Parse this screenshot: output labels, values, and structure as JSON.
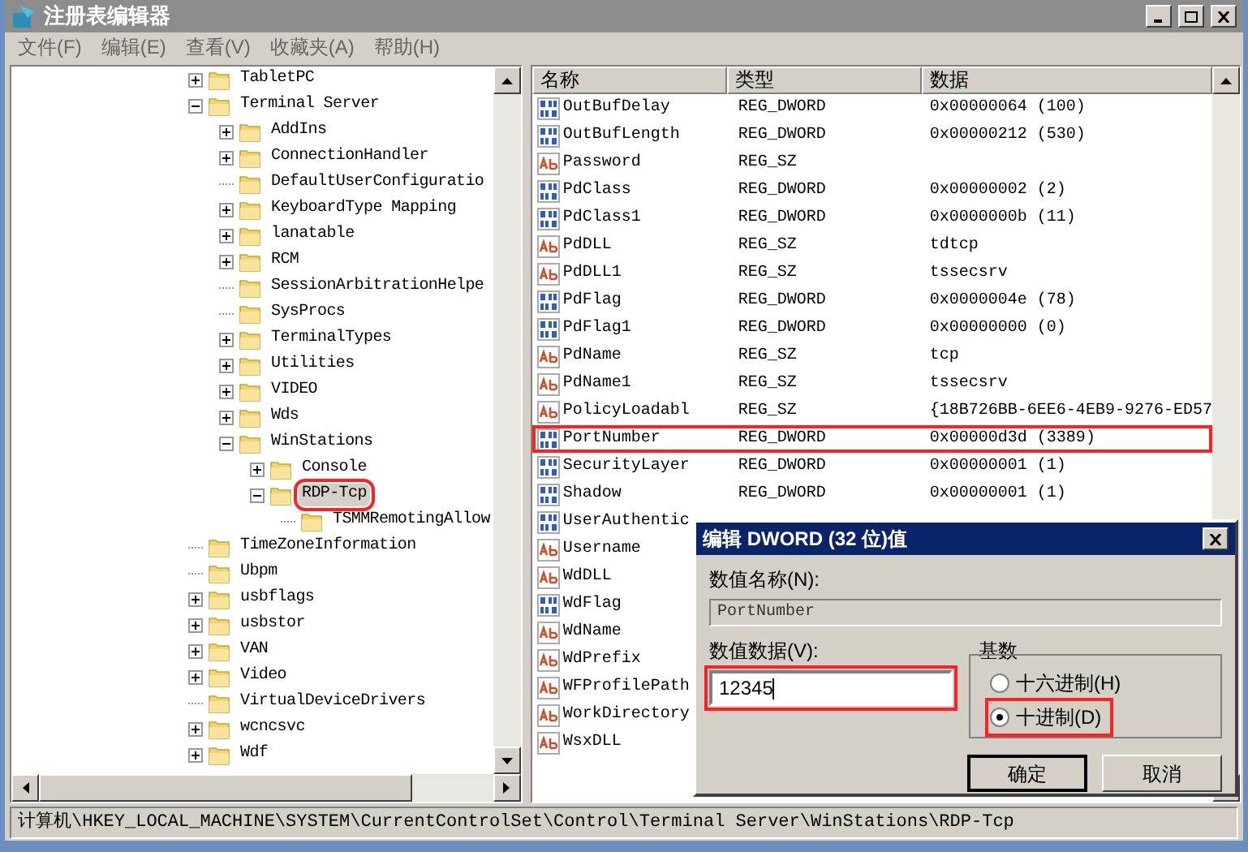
{
  "window": {
    "title": "注册表编辑器"
  },
  "menu": [
    "文件(F)",
    "编辑(E)",
    "查看(V)",
    "收藏夹(A)",
    "帮助(H)"
  ],
  "tree": [
    {
      "label": "TabletPC",
      "expanded": false,
      "selected": false,
      "marked": false
    },
    {
      "label": "Terminal Server",
      "expanded": true,
      "selected": false,
      "marked": false,
      "children": [
        {
          "label": "AddIns",
          "expanded": false,
          "selected": false,
          "marked": false
        },
        {
          "label": "ConnectionHandler",
          "expanded": false,
          "selected": false,
          "marked": false
        },
        {
          "label": "DefaultUserConfiguratio",
          "selected": false,
          "marked": false
        },
        {
          "label": "KeyboardType Mapping",
          "expanded": false,
          "selected": false,
          "marked": false
        },
        {
          "label": "lanatable",
          "expanded": false,
          "selected": false,
          "marked": false
        },
        {
          "label": "RCM",
          "expanded": false,
          "selected": false,
          "marked": false
        },
        {
          "label": "SessionArbitrationHelpe",
          "selected": false,
          "marked": false
        },
        {
          "label": "SysProcs",
          "selected": false,
          "marked": false
        },
        {
          "label": "TerminalTypes",
          "expanded": false,
          "selected": false,
          "marked": false
        },
        {
          "label": "Utilities",
          "expanded": false,
          "selected": false,
          "marked": false
        },
        {
          "label": "VIDEO",
          "expanded": false,
          "selected": false,
          "marked": false
        },
        {
          "label": "Wds",
          "expanded": false,
          "selected": false,
          "marked": false
        },
        {
          "label": "WinStations",
          "expanded": true,
          "selected": false,
          "marked": false,
          "children": [
            {
              "label": "Console",
              "expanded": false,
              "selected": false,
              "marked": false
            },
            {
              "label": "RDP-Tcp",
              "expanded": true,
              "selected": true,
              "marked": true,
              "children": [
                {
                  "label": "TSMMRemotingAllow",
                  "selected": false,
                  "marked": false
                }
              ]
            }
          ]
        }
      ]
    },
    {
      "label": "TimeZoneInformation",
      "selected": false,
      "marked": false
    },
    {
      "label": "Ubpm",
      "selected": false,
      "marked": false
    },
    {
      "label": "usbflags",
      "expanded": false,
      "selected": false,
      "marked": false
    },
    {
      "label": "usbstor",
      "expanded": false,
      "selected": false,
      "marked": false
    },
    {
      "label": "VAN",
      "expanded": false,
      "selected": false,
      "marked": false
    },
    {
      "label": "Video",
      "expanded": false,
      "selected": false,
      "marked": false
    },
    {
      "label": "VirtualDeviceDrivers",
      "selected": false,
      "marked": false
    },
    {
      "label": "wcncsvc",
      "expanded": false,
      "selected": false,
      "marked": false
    },
    {
      "label": "Wdf",
      "expanded": false,
      "selected": false,
      "marked": false
    }
  ],
  "values": {
    "columns": [
      "名称",
      "类型",
      "数据"
    ],
    "rows": [
      {
        "kind": "dword",
        "name": "OutBufDelay",
        "type": "REG_DWORD",
        "data": "0x00000064 (100)",
        "marked": false
      },
      {
        "kind": "dword",
        "name": "OutBufLength",
        "type": "REG_DWORD",
        "data": "0x00000212 (530)",
        "marked": false
      },
      {
        "kind": "string",
        "name": "Password",
        "type": "REG_SZ",
        "marked": false
      },
      {
        "kind": "dword",
        "name": "PdClass",
        "type": "REG_DWORD",
        "data": "0x00000002 (2)",
        "marked": false
      },
      {
        "kind": "dword",
        "name": "PdClass1",
        "type": "REG_DWORD",
        "data": "0x0000000b (11)",
        "marked": false
      },
      {
        "kind": "string",
        "name": "PdDLL",
        "type": "REG_SZ",
        "data": "tdtcp",
        "marked": false
      },
      {
        "kind": "string",
        "name": "PdDLL1",
        "type": "REG_SZ",
        "data": "tssecsrv",
        "marked": false
      },
      {
        "kind": "dword",
        "name": "PdFlag",
        "type": "REG_DWORD",
        "data": "0x0000004e (78)",
        "marked": false
      },
      {
        "kind": "dword",
        "name": "PdFlag1",
        "type": "REG_DWORD",
        "data": "0x00000000 (0)",
        "marked": false
      },
      {
        "kind": "string",
        "name": "PdName",
        "type": "REG_SZ",
        "data": "tcp",
        "marked": false
      },
      {
        "kind": "string",
        "name": "PdName1",
        "type": "REG_SZ",
        "data": "tssecsrv",
        "marked": false
      },
      {
        "kind": "string",
        "name": "PolicyLoadabl",
        "type": "REG_SZ",
        "data": "{18B726BB-6EE6-4EB9-9276-ED57",
        "marked": false
      },
      {
        "kind": "dword",
        "name": "PortNumber",
        "type": "REG_DWORD",
        "data": "0x00000d3d (3389)",
        "marked": true
      },
      {
        "kind": "dword",
        "name": "SecurityLayer",
        "type": "REG_DWORD",
        "data": "0x00000001 (1)",
        "marked": false
      },
      {
        "kind": "dword",
        "name": "Shadow",
        "type": "REG_DWORD",
        "data": "0x00000001 (1)",
        "marked": false
      },
      {
        "kind": "dword",
        "name": "UserAuthentic",
        "marked": false
      },
      {
        "kind": "string",
        "name": "Username",
        "marked": false
      },
      {
        "kind": "string",
        "name": "WdDLL",
        "marked": false
      },
      {
        "kind": "dword",
        "name": "WdFlag",
        "marked": false
      },
      {
        "kind": "string",
        "name": "WdName",
        "marked": false
      },
      {
        "kind": "string",
        "name": "WdPrefix",
        "marked": false
      },
      {
        "kind": "string",
        "name": "WFProfilePath",
        "marked": false
      },
      {
        "kind": "string",
        "name": "WorkDirectory",
        "marked": false
      },
      {
        "kind": "string",
        "name": "WsxDLL",
        "marked": false
      }
    ]
  },
  "dialog": {
    "title": "编辑 DWORD (32 位)值",
    "name_label": "数值名称(N):",
    "name_value": "PortNumber",
    "data_label": "数值数据(V):",
    "data_value": "12345",
    "data_marked": true,
    "base_label": "基数",
    "base_options": [
      {
        "label": "十六进制(H)",
        "selected": false,
        "marked": false
      },
      {
        "label": "十进制(D)",
        "selected": true,
        "marked": true
      }
    ],
    "buttons": [
      {
        "label": "确定",
        "default": true
      },
      {
        "label": "取消",
        "default": false
      }
    ]
  },
  "status_bar": "计算机\\HKEY_LOCAL_MACHINE\\SYSTEM\\CurrentControlSet\\Control\\Terminal Server\\WinStations\\RDP-Tcp"
}
